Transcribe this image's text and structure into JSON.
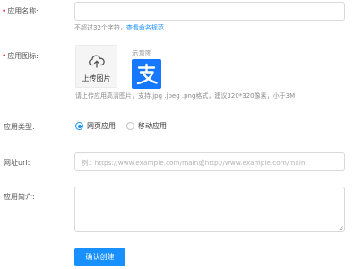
{
  "form": {
    "app_name": {
      "label": "应用名称:",
      "value": "",
      "hint": "不超过32个字符，",
      "hint_link": "查看命名规范"
    },
    "app_icon": {
      "label": "应用图标:",
      "upload_text": "上传图片",
      "sample_label": "示意图",
      "sample_icon": "alipay-icon",
      "hint": "请上传应用高清图片，支持.jpg .jpeg .png格式，建议320*320像素，小于3M"
    },
    "app_type": {
      "label": "应用类型:",
      "options": [
        {
          "label": "网页应用",
          "selected": true
        },
        {
          "label": "移动应用",
          "selected": false
        }
      ]
    },
    "url": {
      "label": "网址url:",
      "placeholder": "例：https://www.example.com/main或http://www.example.com/main",
      "value": ""
    },
    "intro": {
      "label": "应用简介:",
      "value": ""
    },
    "submit_label": "确认创建"
  },
  "colors": {
    "accent": "#1890ff",
    "required": "#f5222d",
    "alipay_blue": "#1677ff"
  }
}
